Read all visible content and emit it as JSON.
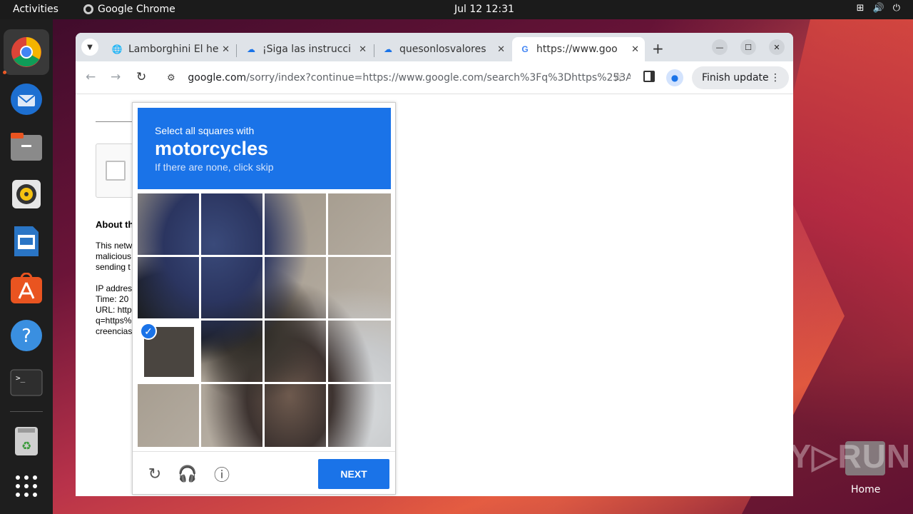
{
  "topbar": {
    "activities": "Activities",
    "app_name": "Google Chrome",
    "clock": "Jul 12  12:31"
  },
  "browser": {
    "tabs": [
      {
        "title": "Lamborghini El he",
        "favicon": "globe-icon"
      },
      {
        "title": "¡Siga las instrucci",
        "favicon": "download-cloud-icon"
      },
      {
        "title": "quesonlosvalores",
        "favicon": "download-cloud-icon"
      },
      {
        "title": "https://www.goo",
        "favicon": "google-icon",
        "active": true
      }
    ],
    "url_host": "google.com",
    "url_path": "/sorry/index?continue=https://www.google.com/search%3Fq%3Dhttps%253A...",
    "finish_update": "Finish update"
  },
  "page": {
    "about_heading": "About th",
    "para_lines": [
      "This netw",
      "malicious",
      "sending t"
    ],
    "info_lines": [
      "IP addres",
      "Time: 20",
      "URL: http",
      "q=https%",
      "creencias"
    ]
  },
  "captcha": {
    "instruction": "Select all squares with",
    "target": "motorcycles",
    "hint": "If there are none, click skip",
    "next_label": "NEXT",
    "grid_size": 4,
    "selected_tiles": [
      8
    ]
  },
  "desktop": {
    "watermark": "ANY▷RUN",
    "home_label": "Home"
  },
  "colors": {
    "accent": "#1a73e8",
    "ubuntu_orange": "#e95420"
  }
}
